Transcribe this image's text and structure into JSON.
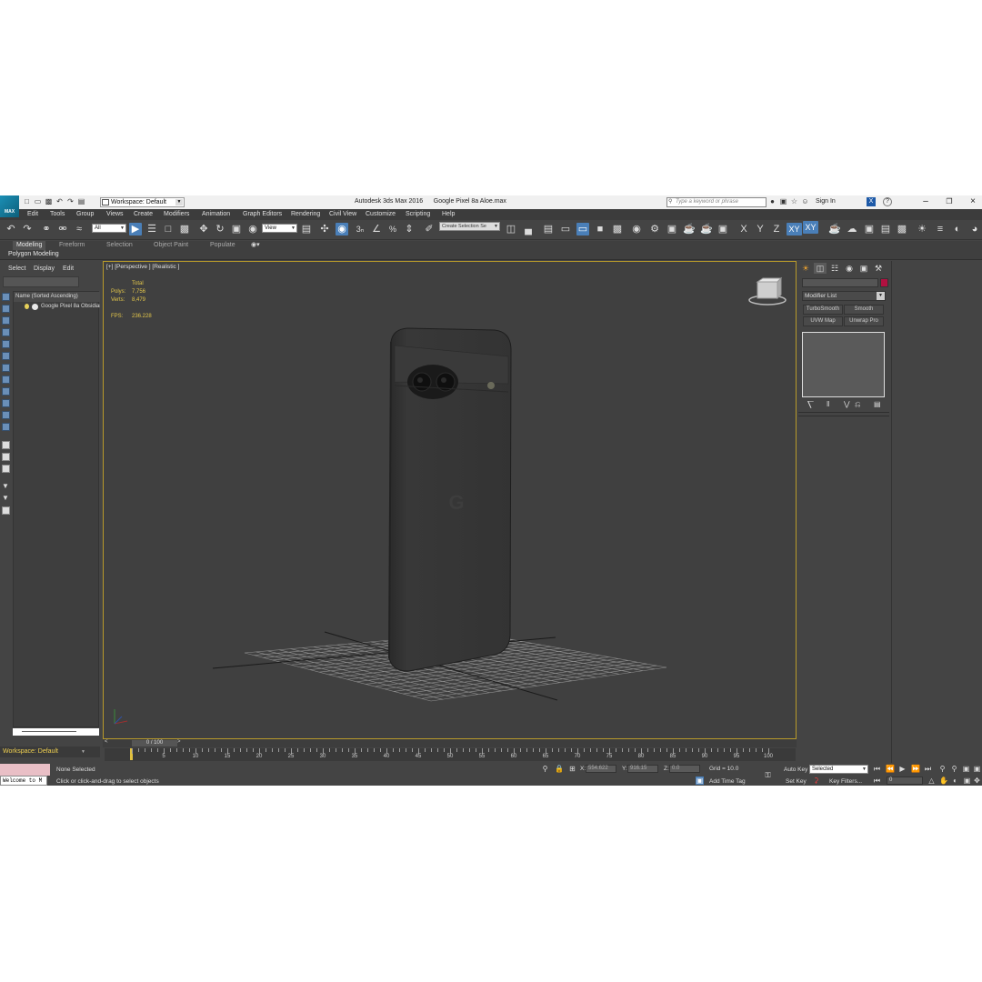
{
  "window": {
    "workspace_label": "Workspace: Default",
    "app_title": "Autodesk 3ds Max 2016      Google Pixel 8a Aloe.max",
    "search_placeholder": "Type a keyword or phrase",
    "sign_in": "Sign In",
    "logo_text": "MAX"
  },
  "menu": [
    "Edit",
    "Tools",
    "Group",
    "Views",
    "Create",
    "Modifiers",
    "Animation",
    "Graph Editors",
    "Rendering",
    "Civil View",
    "Customize",
    "Scripting",
    "Help"
  ],
  "toolbar": {
    "selection_filter": "All",
    "ref_coord": "View",
    "selection_set": "Create Selection Se",
    "axis_x": "X",
    "axis_y": "Y",
    "axis_z": "Z",
    "axis_xy": "XY",
    "axis_xy2": "XY"
  },
  "ribbon": {
    "tabs": [
      "Modeling",
      "Freeform",
      "Selection",
      "Object Paint",
      "Populate"
    ],
    "active_tab": "Modeling",
    "panel_label": "Polygon Modeling"
  },
  "explorer": {
    "tabs": [
      "Select",
      "Display",
      "Edit"
    ],
    "header": "Name (Sorted Ascending)",
    "items": [
      {
        "name": "Google Pixel 8a Obsidian"
      }
    ]
  },
  "viewport": {
    "label": "[+] [Perspective ] [Realistic ]",
    "stats": {
      "total_label": "Total",
      "polys_label": "Polys:",
      "polys_value": "7,756",
      "verts_label": "Verts:",
      "verts_value": "8,479",
      "fps_label": "FPS:",
      "fps_value": "236.228"
    },
    "phone_logo": "G"
  },
  "timeline": {
    "slider_value": "0 / 100",
    "left_arrow": "<",
    "right_arrow": ">",
    "ticks": [
      "0",
      "5",
      "10",
      "15",
      "20",
      "25",
      "30",
      "35",
      "40",
      "45",
      "50",
      "55",
      "60",
      "65",
      "70",
      "75",
      "80",
      "85",
      "90",
      "95",
      "100"
    ]
  },
  "status": {
    "workspace": "Workspace: Default",
    "welcome": "Welcome to M",
    "selection_text": "None Selected",
    "prompt": "Click or click-and-drag to select objects",
    "x_label": "X:",
    "x_value": "554.622",
    "y_label": "Y:",
    "y_value": "916.15",
    "z_label": "Z:",
    "z_value": "0.0",
    "grid": "Grid = 10.0",
    "add_time_tag": "Add Time Tag",
    "auto_key": "Auto Key",
    "set_key": "Set Key",
    "selected_option": "Selected",
    "key_filters": "Key Filters...",
    "frame": "0"
  },
  "command_panel": {
    "modifier_list": "Modifier List",
    "buttons": [
      "TurboSmooth",
      "Smooth",
      "UVW Map",
      "Unwrap Pro"
    ]
  },
  "colors": {
    "accent_blue": "#4a7fb8",
    "viewport_border": "#b89a2a",
    "stats_yellow": "#e3c64a",
    "object_color": "#b01040"
  }
}
